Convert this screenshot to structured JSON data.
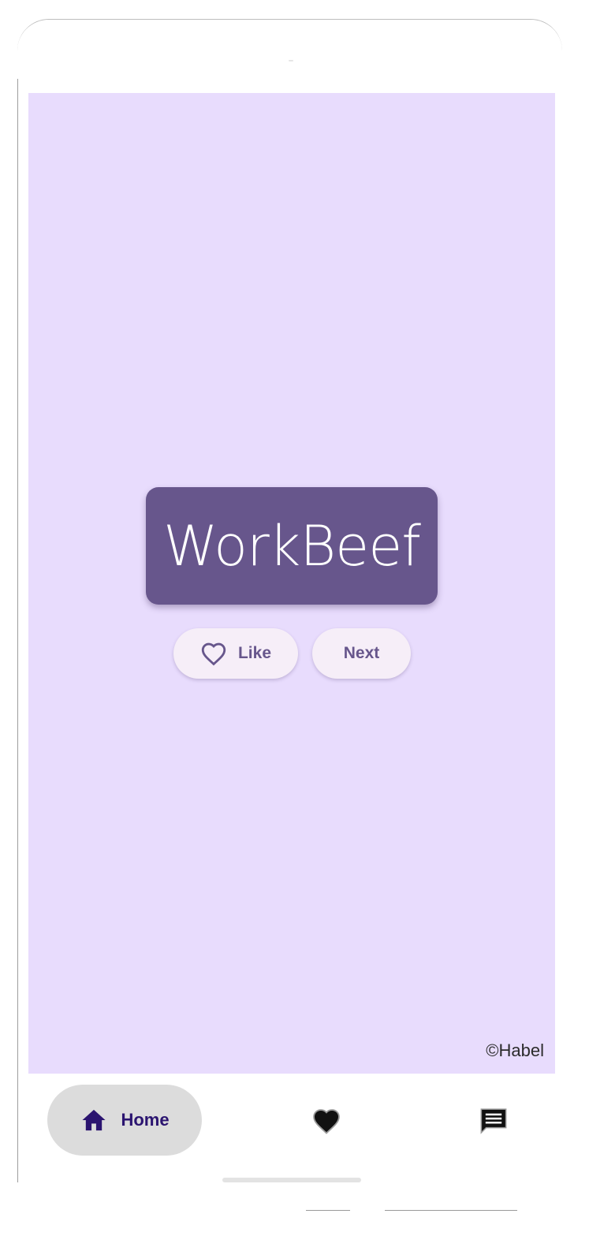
{
  "app": {
    "title": "WorkBeef",
    "background_color": "#e8dcfd",
    "card_color": "#67568c"
  },
  "actions": {
    "like_label": "Like",
    "like_icon": "heart-outline-icon",
    "next_label": "Next"
  },
  "footer": {
    "copyright": "©Habel"
  },
  "navbar": {
    "home_label": "Home",
    "home_icon": "home-icon",
    "favorites_icon": "heart-filled-icon",
    "messages_icon": "message-icon",
    "selected": "Home",
    "accent_color": "#2b1470"
  }
}
